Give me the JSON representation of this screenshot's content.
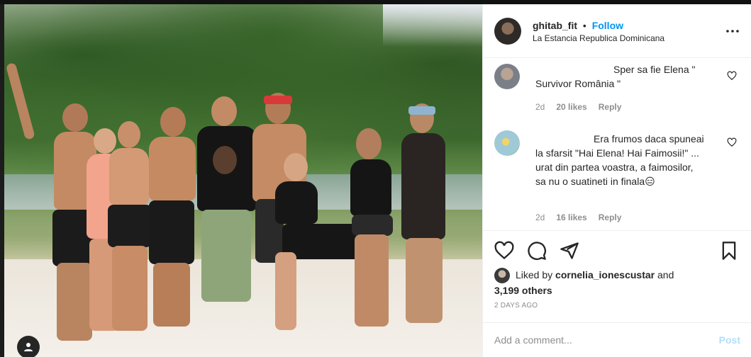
{
  "post": {
    "username": "ghitab_fit",
    "follow_label": "Follow",
    "separator": "•",
    "location": "La Estancia Republica Dominicana",
    "more_icon": "more-horizontal-icon"
  },
  "comments": [
    {
      "text": "Sper sa fie Elena \" Survivor România \"",
      "time": "2d",
      "likes": "20 likes",
      "reply": "Reply"
    },
    {
      "text": "Era frumos daca spuneai la sfarsit \"Hai Elena! Hai Faimosii!\" ... urat din partea voastra, a faimosilor, sa nu o suatineti in finala😑",
      "time": "2d",
      "likes": "16 likes",
      "reply": "Reply"
    }
  ],
  "actions": {
    "icons": [
      "heart-icon",
      "comment-icon",
      "share-icon",
      "bookmark-icon"
    ],
    "liked_by_prefix": "Liked by",
    "liked_by_user": "cornelia_ionescustar",
    "liked_by_and": "and",
    "liked_by_others": "3,199 others",
    "timestamp": "2 DAYS AGO"
  },
  "add_comment": {
    "placeholder": "Add a comment...",
    "post_label": "Post"
  },
  "colors": {
    "accent": "#0095f6",
    "post_disabled": "#b2dffc",
    "muted": "#8e8e8e"
  }
}
